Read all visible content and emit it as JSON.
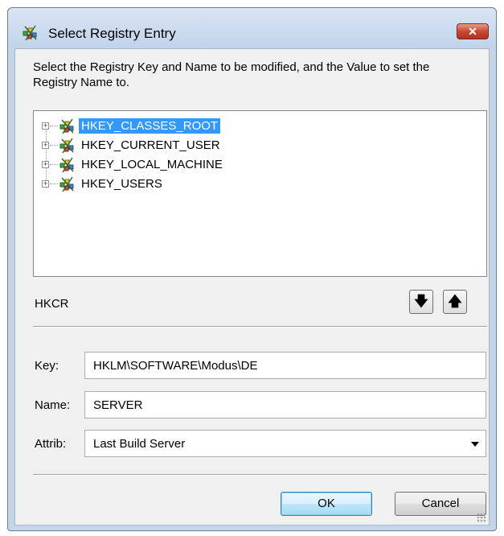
{
  "window": {
    "title": "Select Registry Entry",
    "close_glyph": "✕",
    "icon": "registry-icon"
  },
  "description": "Select the Registry Key and Name to be modified, and the Value to set the Registry Name to.",
  "tree": {
    "items": [
      {
        "label": "HKEY_CLASSES_ROOT",
        "selected": true,
        "expander": "+"
      },
      {
        "label": "HKEY_CURRENT_USER",
        "selected": false,
        "expander": "+"
      },
      {
        "label": "HKEY_LOCAL_MACHINE",
        "selected": false,
        "expander": "+"
      },
      {
        "label": "HKEY_USERS",
        "selected": false,
        "expander": "+"
      }
    ]
  },
  "current_path": "HKCR",
  "move_down_glyph": "🡇",
  "move_up_glyph": "🡅",
  "fields": {
    "key": {
      "label": "Key:",
      "value": "HKLM\\SOFTWARE\\Modus\\DE"
    },
    "name": {
      "label": "Name:",
      "value": "SERVER"
    },
    "attrib": {
      "label": "Attrib:",
      "value": "Last Build Server"
    }
  },
  "buttons": {
    "ok": "OK",
    "cancel": "Cancel"
  },
  "colors": {
    "selection": "#3399ff",
    "close_button": "#c64a36",
    "frame": "#c4d5ea"
  }
}
